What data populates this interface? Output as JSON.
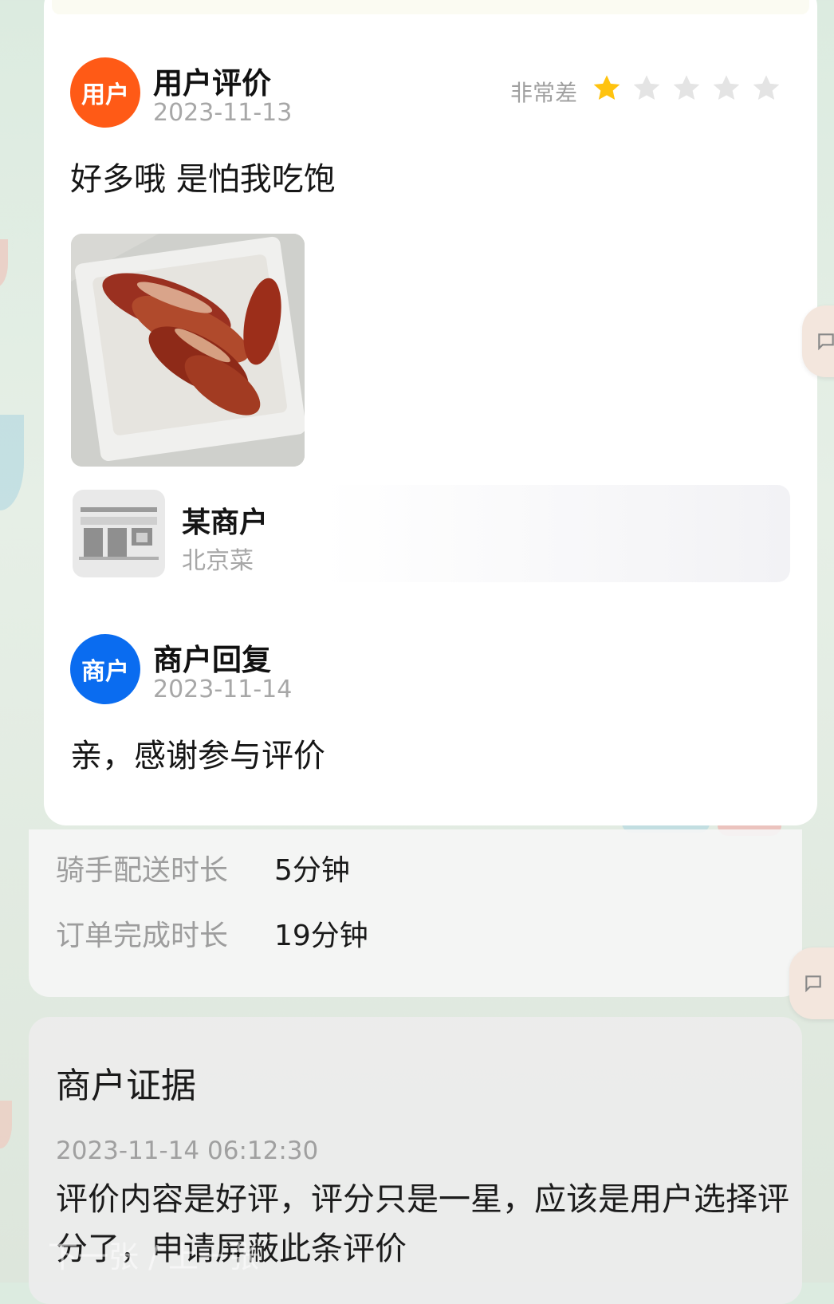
{
  "review": {
    "user_avatar": "用户",
    "user_title": "用户评价",
    "user_date": "2023-11-13",
    "rating_label": "非常差",
    "rating": 1,
    "rating_max": 5,
    "text": "好多哦 是怕我吃饱",
    "shop": {
      "name": "某商户",
      "category": "北京菜"
    }
  },
  "reply": {
    "merchant_avatar": "商户",
    "title": "商户回复",
    "date": "2023-11-14",
    "text": "亲，感谢参与评价"
  },
  "stats": [
    {
      "label": "骑手配送时长",
      "value": "5分钟"
    },
    {
      "label": "订单完成时长",
      "value": "19分钟"
    }
  ],
  "evidence": {
    "title": "商户证据",
    "time": "2023-11-14 06:12:30",
    "text": "评价内容是好评，评分只是一星，应该是用户选择评分了，申请屏蔽此条评价"
  },
  "watermark": "下一张 / 上一张",
  "colors": {
    "user_avatar": "#ff5a16",
    "merchant_avatar": "#0a6cf0",
    "star_on": "#ffc30f",
    "star_off": "#e4e4e4"
  },
  "icons": [
    "storefront-icon",
    "chat-icon",
    "star-icon"
  ]
}
